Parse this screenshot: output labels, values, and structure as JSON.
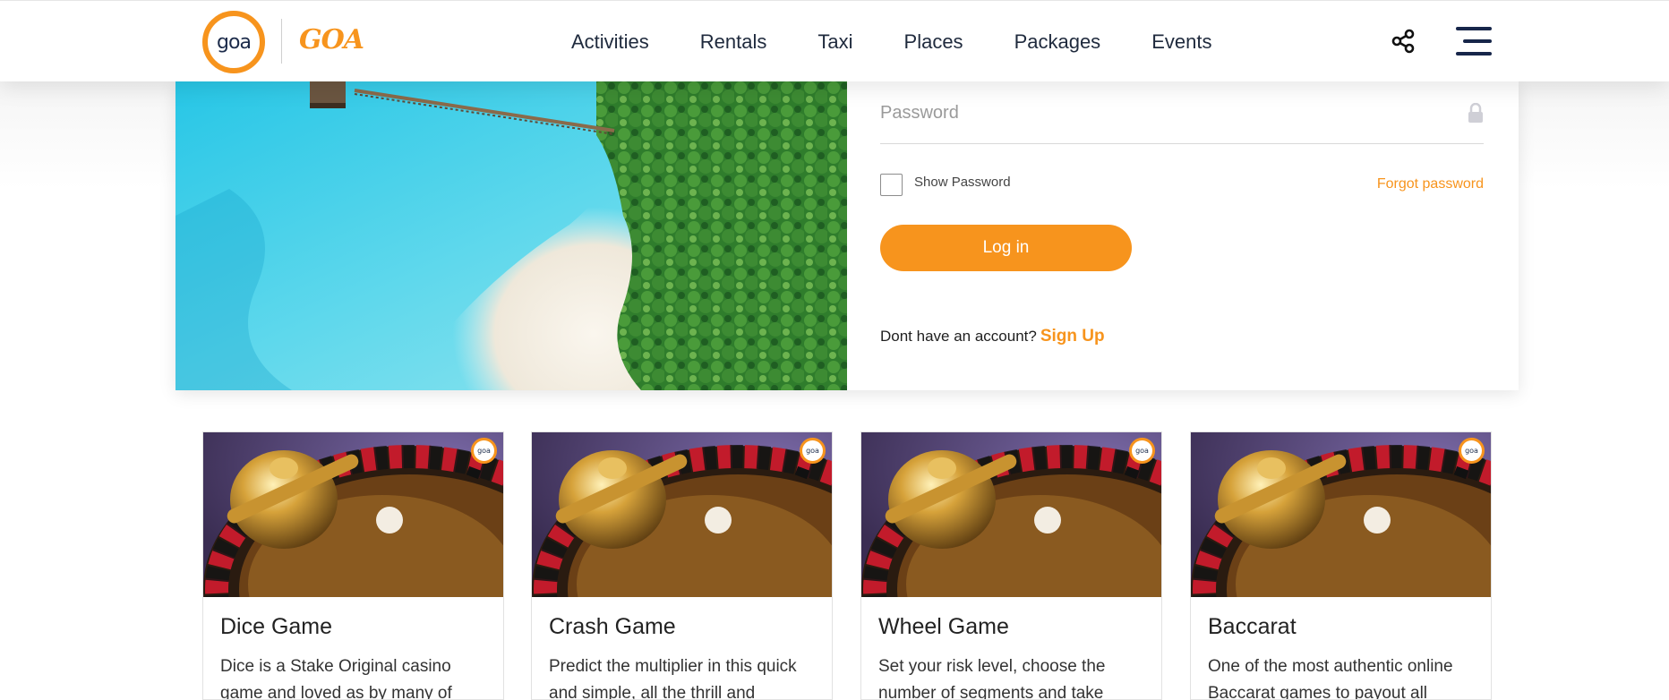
{
  "header": {
    "logo_text": "goa",
    "brand_text": "GOA",
    "brand_sub": "",
    "nav": [
      "Activities",
      "Rentals",
      "Taxi",
      "Places",
      "Packages",
      "Events"
    ]
  },
  "login": {
    "password_placeholder": "Password",
    "show_password": "Show Password",
    "forgot_password": "Forgot password",
    "login_button": "Log in",
    "no_account": "Dont have an account?",
    "sign_up": "Sign Up"
  },
  "cards": [
    {
      "title": "Dice Game",
      "desc": "Dice is a Stake Original casino game and loved as by many of"
    },
    {
      "title": "Crash Game",
      "desc": "Predict the multiplier in this quick and simple, all the thrill and"
    },
    {
      "title": "Wheel Game",
      "desc": "Set your risk level, choose the number of segments and take"
    },
    {
      "title": "Baccarat",
      "desc": "One of the most authentic online Baccarat games to payout all"
    }
  ],
  "colors": {
    "accent": "#f7941d",
    "navy": "#17264a"
  }
}
